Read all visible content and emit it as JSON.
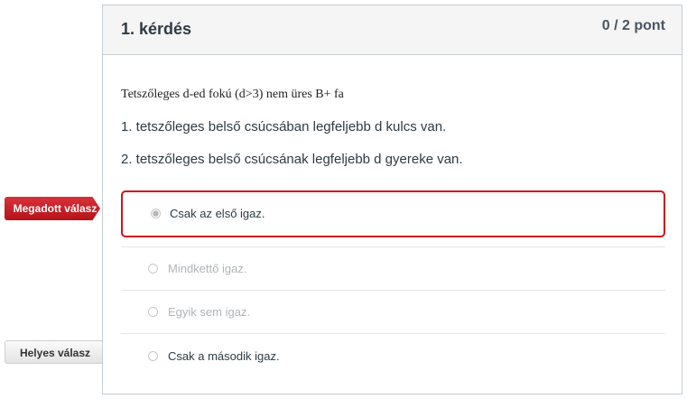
{
  "question": {
    "title": "1. kérdés",
    "points": "0 / 2 pont",
    "intro": "Tetszőleges d-ed fokú (d>3) nem üres  B+ fa",
    "statements": [
      "1. tetszőleges belső csúcsában legfeljebb d kulcs van.",
      "2. tetszőleges belső csúcsának legfeljebb d gyereke van."
    ]
  },
  "answers": [
    {
      "label": "Csak az első igaz.",
      "selected": true
    },
    {
      "label": "Mindkettő igaz.",
      "selected": false
    },
    {
      "label": "Egyik sem igaz.",
      "selected": false
    },
    {
      "label": "Csak a második igaz.",
      "selected": false
    }
  ],
  "tags": {
    "given": "Megadott válasz",
    "correct": "Helyes válasz"
  },
  "colors": {
    "given_accent": "#d0121a",
    "text": "#2d3b45",
    "muted": "#b0b5b9"
  }
}
